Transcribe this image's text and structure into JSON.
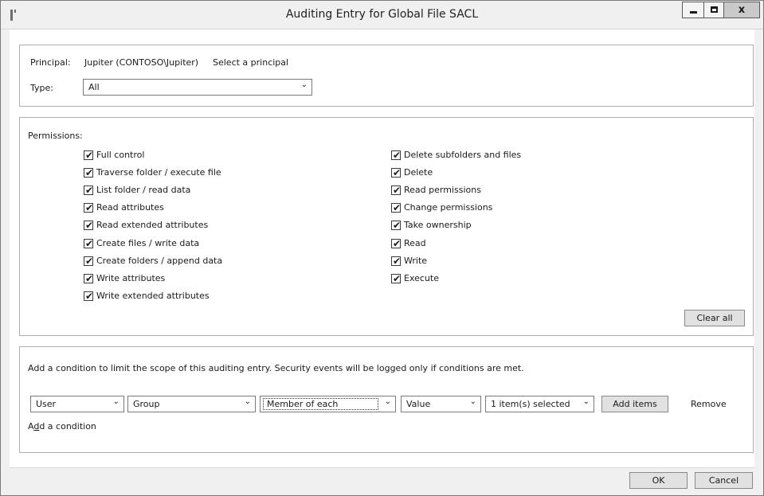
{
  "window": {
    "title": "Auditing Entry for Global File SACL",
    "controls": {
      "minimize": "minimize",
      "maximize": "maximize",
      "close": "x"
    }
  },
  "principal": {
    "label": "Principal:",
    "value": "Jupiter (CONTOSO\\Jupiter)",
    "select_link": "Select a principal"
  },
  "type": {
    "label": "Type:",
    "value": "All"
  },
  "permissions": {
    "label": "Permissions:",
    "left": [
      {
        "label": "Full control",
        "checked": true
      },
      {
        "label": "Traverse folder / execute file",
        "checked": true
      },
      {
        "label": "List folder / read data",
        "checked": true
      },
      {
        "label": "Read attributes",
        "checked": true
      },
      {
        "label": "Read extended attributes",
        "checked": true
      },
      {
        "label": "Create files / write data",
        "checked": true
      },
      {
        "label": "Create folders / append data",
        "checked": true
      },
      {
        "label": "Write attributes",
        "checked": true
      },
      {
        "label": "Write extended attributes",
        "checked": true
      }
    ],
    "right": [
      {
        "label": "Delete subfolders and files",
        "checked": true
      },
      {
        "label": "Delete",
        "checked": true
      },
      {
        "label": "Read permissions",
        "checked": true
      },
      {
        "label": "Change permissions",
        "checked": true
      },
      {
        "label": "Take ownership",
        "checked": true
      },
      {
        "label": "Read",
        "checked": true
      },
      {
        "label": "Write",
        "checked": true
      },
      {
        "label": "Execute",
        "checked": true
      }
    ],
    "clear_all": "Clear all"
  },
  "condition": {
    "description": "Add a condition to limit the scope of this auditing entry. Security events will be logged only if conditions are met.",
    "row": {
      "attribute_source": "User",
      "attribute": "Group",
      "operator": "Member of each",
      "value_type": "Value",
      "value": "1 item(s) selected"
    },
    "add_items": "Add items",
    "remove": "Remove",
    "add_condition_prefix": "A",
    "add_condition_accel": "d",
    "add_condition_rest": "d a condition"
  },
  "footer": {
    "ok": "OK",
    "cancel": "Cancel"
  },
  "icons": {
    "app": "app-icon",
    "chevron": "chevron-down-icon",
    "check": "checkmark-icon"
  }
}
